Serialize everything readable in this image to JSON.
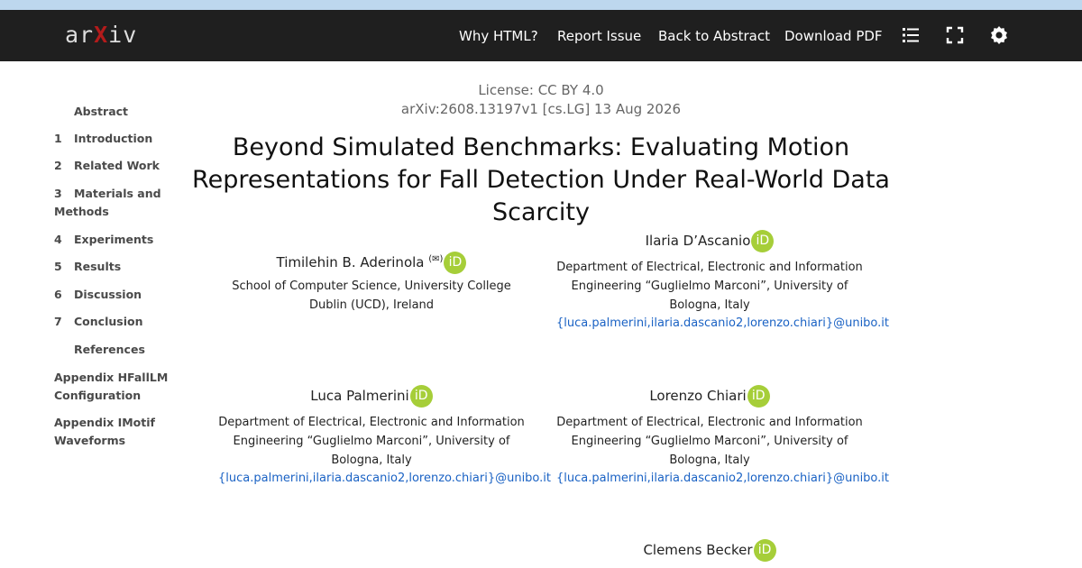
{
  "nav": {
    "logo": "arXiv",
    "links": [
      "Why HTML?",
      "Report Issue",
      "Back to Abstract",
      "Download PDF"
    ],
    "icons": [
      "list-icon",
      "fullscreen-icon",
      "settings-icon"
    ]
  },
  "toc": [
    {
      "num": "",
      "label": "Abstract"
    },
    {
      "num": "1",
      "label": "Introduction"
    },
    {
      "num": "2",
      "label": "Related Work"
    },
    {
      "num": "3",
      "label": "Materials and Methods"
    },
    {
      "num": "4",
      "label": "Experiments"
    },
    {
      "num": "5",
      "label": "Results"
    },
    {
      "num": "6",
      "label": "Discussion"
    },
    {
      "num": "7",
      "label": "Conclusion"
    },
    {
      "num": "",
      "label": "References"
    },
    {
      "num": "",
      "label": "Appendix HFallLM Configuration"
    },
    {
      "num": "",
      "label": "Appendix IMotif Waveforms"
    }
  ],
  "paper": {
    "license": "License: CC BY 4.0",
    "arxiv_id": "arXiv:2608.13197v1 [cs.LG] 13 Aug 2026",
    "title_line1": "Beyond Simulated Benchmarks: Evaluating Motion",
    "title_line2": "Representations for Fall Detection Under Real-World Data Scarcity"
  },
  "authors": [
    {
      "name": "Timilehin B. Aderinola",
      "mark": "(✉)",
      "aff": "School of Computer Science, University College Dublin (UCD), Ireland",
      "email": ""
    },
    {
      "name": "Ilaria D’Ascanio",
      "mark": "",
      "aff": "Department of Electrical, Electronic and Information Engineering “Guglielmo Marconi”, University of Bologna, Italy",
      "email": "{luca.palmerini,ilaria.dascanio2,lorenzo.chiari}@unibo.it"
    },
    {
      "name": "Luca Palmerini",
      "mark": "",
      "aff": "Department of Electrical, Electronic and Information Engineering “Guglielmo Marconi”, University of Bologna, Italy",
      "email": "{luca.palmerini,ilaria.dascanio2,lorenzo.chiari}@unibo.it"
    },
    {
      "name": "Lorenzo Chiari",
      "mark": "",
      "aff": "Department of Electrical, Electronic and Information Engineering “Guglielmo Marconi”, University of Bologna, Italy",
      "email": "{luca.palmerini,ilaria.dascanio2,lorenzo.chiari}@unibo.it"
    },
    {
      "name": "Clemens Becker",
      "mark": "",
      "aff": "",
      "email": ""
    }
  ],
  "orcid_glyph": "iD"
}
